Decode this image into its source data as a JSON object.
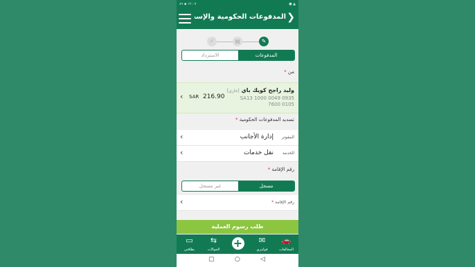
{
  "status": {
    "left": "١٢:٠٧ ▪ ٨٩",
    "right": "● ▲"
  },
  "header": {
    "title": "المدفوعات الحكومية والإست...",
    "back_glyph": "❯"
  },
  "steps": {
    "step1_glyph": "✎",
    "step2_glyph": "▤",
    "step3_glyph": "✓"
  },
  "tabs": {
    "payments": "المدفوعات",
    "refund": "الاسترداد"
  },
  "from": {
    "label": "من",
    "account_name": "وليد راجح كويك باي",
    "account_tag": "[جاري]",
    "iban": "SA13 1000 0049 0935 7600 0105",
    "currency": "SAR",
    "amount": "216.90"
  },
  "government_payment": {
    "label": "تسديد المدفوعات الحكومية"
  },
  "biller": {
    "label": "المفوتر",
    "value": "إدارة الأجانب"
  },
  "service": {
    "label": "الخدمة",
    "value": "نقل خدمات"
  },
  "iqama": {
    "label": "رقم الإقامة",
    "registered": "مسجل",
    "unregistered": "غير مسجل",
    "field_label": "رقم الإقامة"
  },
  "submit_label": "طلب رسوم العملية",
  "bottom_nav": [
    {
      "label": "المخالفات",
      "icon": "🚗"
    },
    {
      "label": "فواتيري",
      "icon": "✉"
    },
    {
      "label": "",
      "icon": "+"
    },
    {
      "label": "الحوالات",
      "icon": "⇆"
    },
    {
      "label": "بطاقتي",
      "icon": "▭"
    }
  ],
  "system_nav": {
    "back": "◁",
    "home": "○",
    "recent": "▢"
  }
}
